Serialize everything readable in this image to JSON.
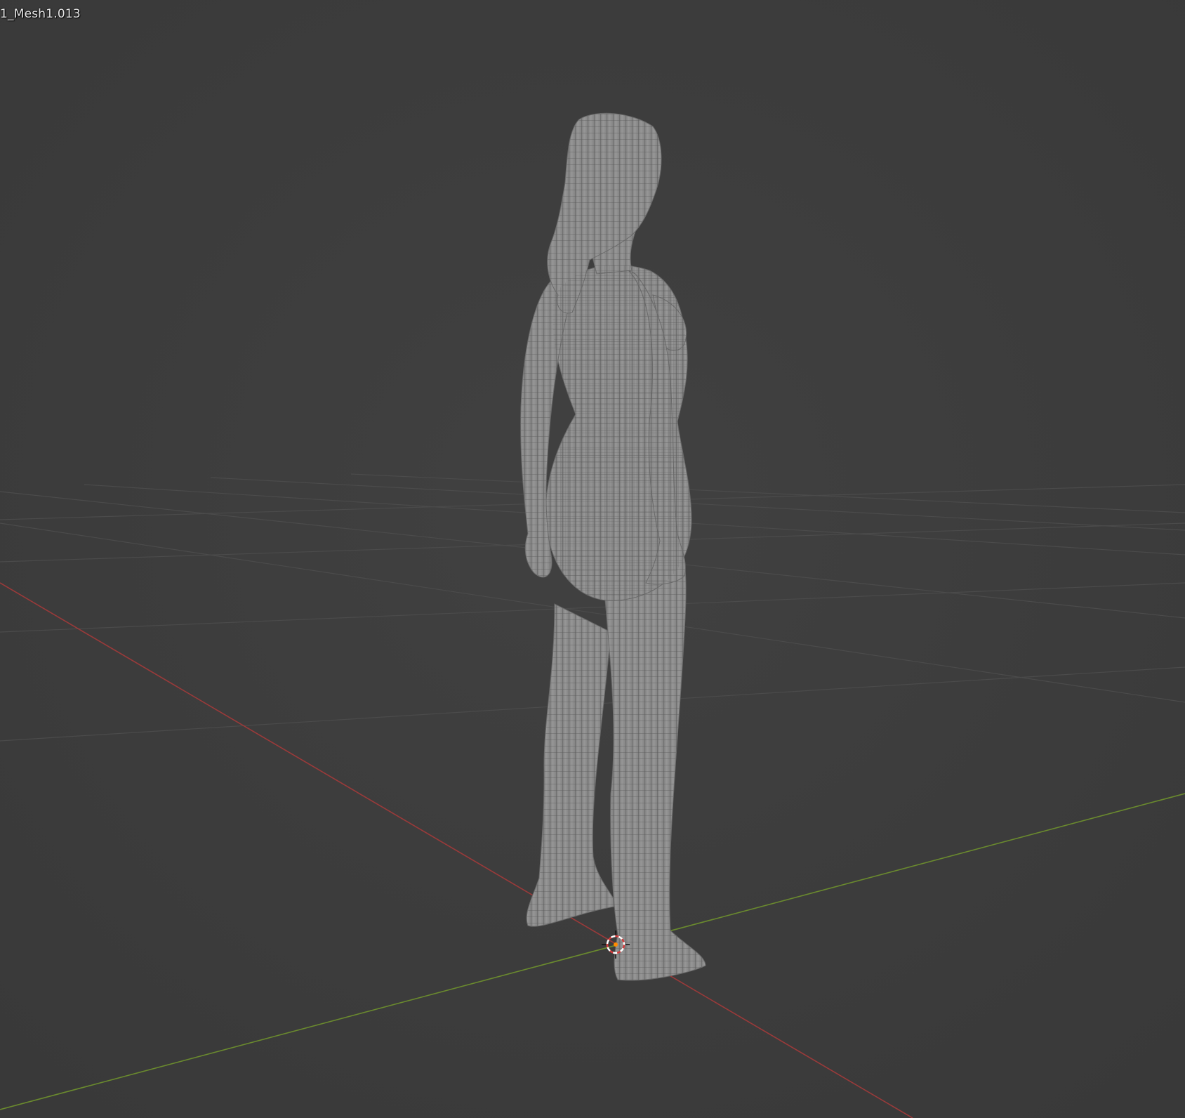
{
  "viewport": {
    "object_name": "1_Mesh1.013",
    "background_color": "#3d3d3d",
    "grid_color": "#4a4a4a",
    "x_axis_color": "#9a3a3a",
    "y_axis_color": "#6a8a2e",
    "mesh_fill_color": "#8e8e8e",
    "mesh_wire_color": "#555555",
    "cursor_colors": [
      "#d23b3b",
      "#ffffff"
    ],
    "origin_color": "#ff8a00"
  }
}
